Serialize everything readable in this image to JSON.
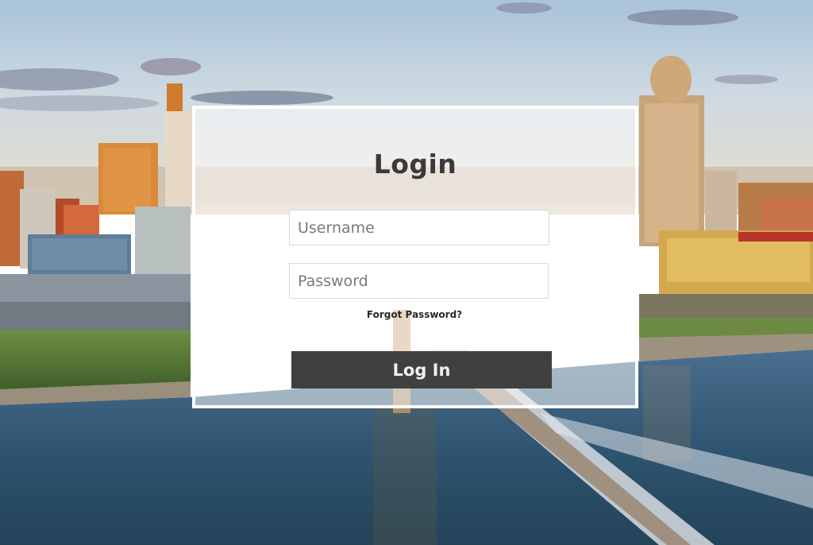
{
  "login": {
    "title": "Login",
    "username_placeholder": "Username",
    "password_placeholder": "Password",
    "forgot_label": "Forgot Password?",
    "submit_label": "Log In"
  },
  "colors": {
    "button_bg": "#404040",
    "card_border": "#ffffff",
    "title_text": "#3a3a3a"
  }
}
